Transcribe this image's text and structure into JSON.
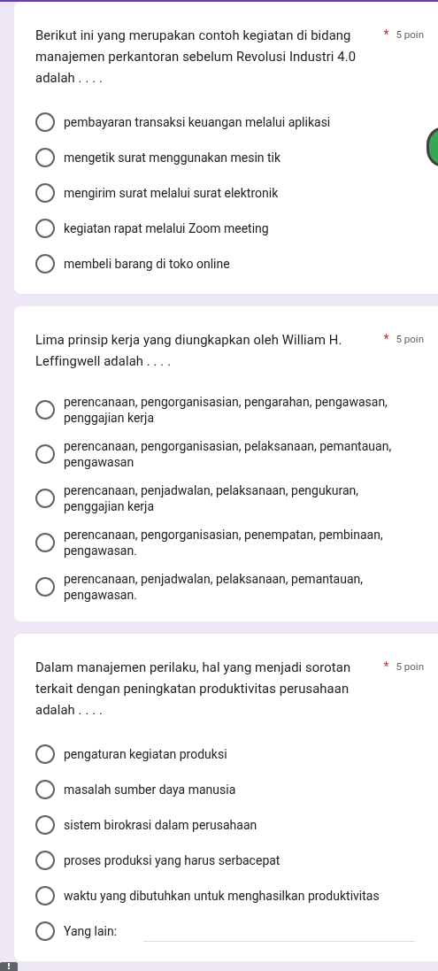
{
  "questions": [
    {
      "title": "Berikut ini yang merupakan contoh kegiatan di bidang manajemen perkantoran sebelum Revolusi Industri 4.0 adalah . . . .",
      "required_mark": "*",
      "points": "5 poin",
      "options": [
        {
          "label": "pembayaran transaksi keuangan melalui aplikasi",
          "selected": false
        },
        {
          "label": "mengetik surat menggunakan mesin tik",
          "selected": false
        },
        {
          "label": "mengirim surat melalui surat elektronik",
          "selected": false
        },
        {
          "label": "kegiatan rapat melalui Zoom meeting",
          "selected": false
        },
        {
          "label": "membeli barang di toko online",
          "selected": false
        }
      ]
    },
    {
      "title": "Lima prinsip kerja yang diungkapkan oleh William H. Leffingwell adalah . . . .",
      "required_mark": "*",
      "points": "5 poin",
      "options": [
        {
          "label": "perencanaan, pengorganisasian, pengarahan, pengawasan, penggajian kerja",
          "selected": false
        },
        {
          "label": "perencanaan, pengorganisasian, pelaksanaan, pemantauan, pengawasan",
          "selected": false
        },
        {
          "label": "perencanaan, penjadwalan, pelaksanaan, pengukuran, penggajian kerja",
          "selected": false
        },
        {
          "label": "perencanaan, pengorganisasian, penempatan, pembinaan, pengawasan.",
          "selected": false
        },
        {
          "label": "perencanaan, penjadwalan, pelaksanaan, pemantauan, pengawasan.",
          "selected": false
        }
      ]
    },
    {
      "title": "Dalam manajemen perilaku, hal yang menjadi sorotan terkait dengan peningkatan produktivitas perusahaan adalah . . . .",
      "required_mark": "*",
      "points": "5 poin",
      "options": [
        {
          "label": "pengaturan kegiatan produksi",
          "selected": false
        },
        {
          "label": "masalah sumber daya manusia",
          "selected": false
        },
        {
          "label": "sistem birokrasi dalam perusahaan",
          "selected": false
        },
        {
          "label": "proses produksi yang harus serbacepat",
          "selected": false
        },
        {
          "label": "waktu yang dibutuhkan untuk menghasilkan produktivitas",
          "selected": false
        }
      ],
      "other": {
        "label": "Yang lain:",
        "selected": false
      }
    }
  ]
}
